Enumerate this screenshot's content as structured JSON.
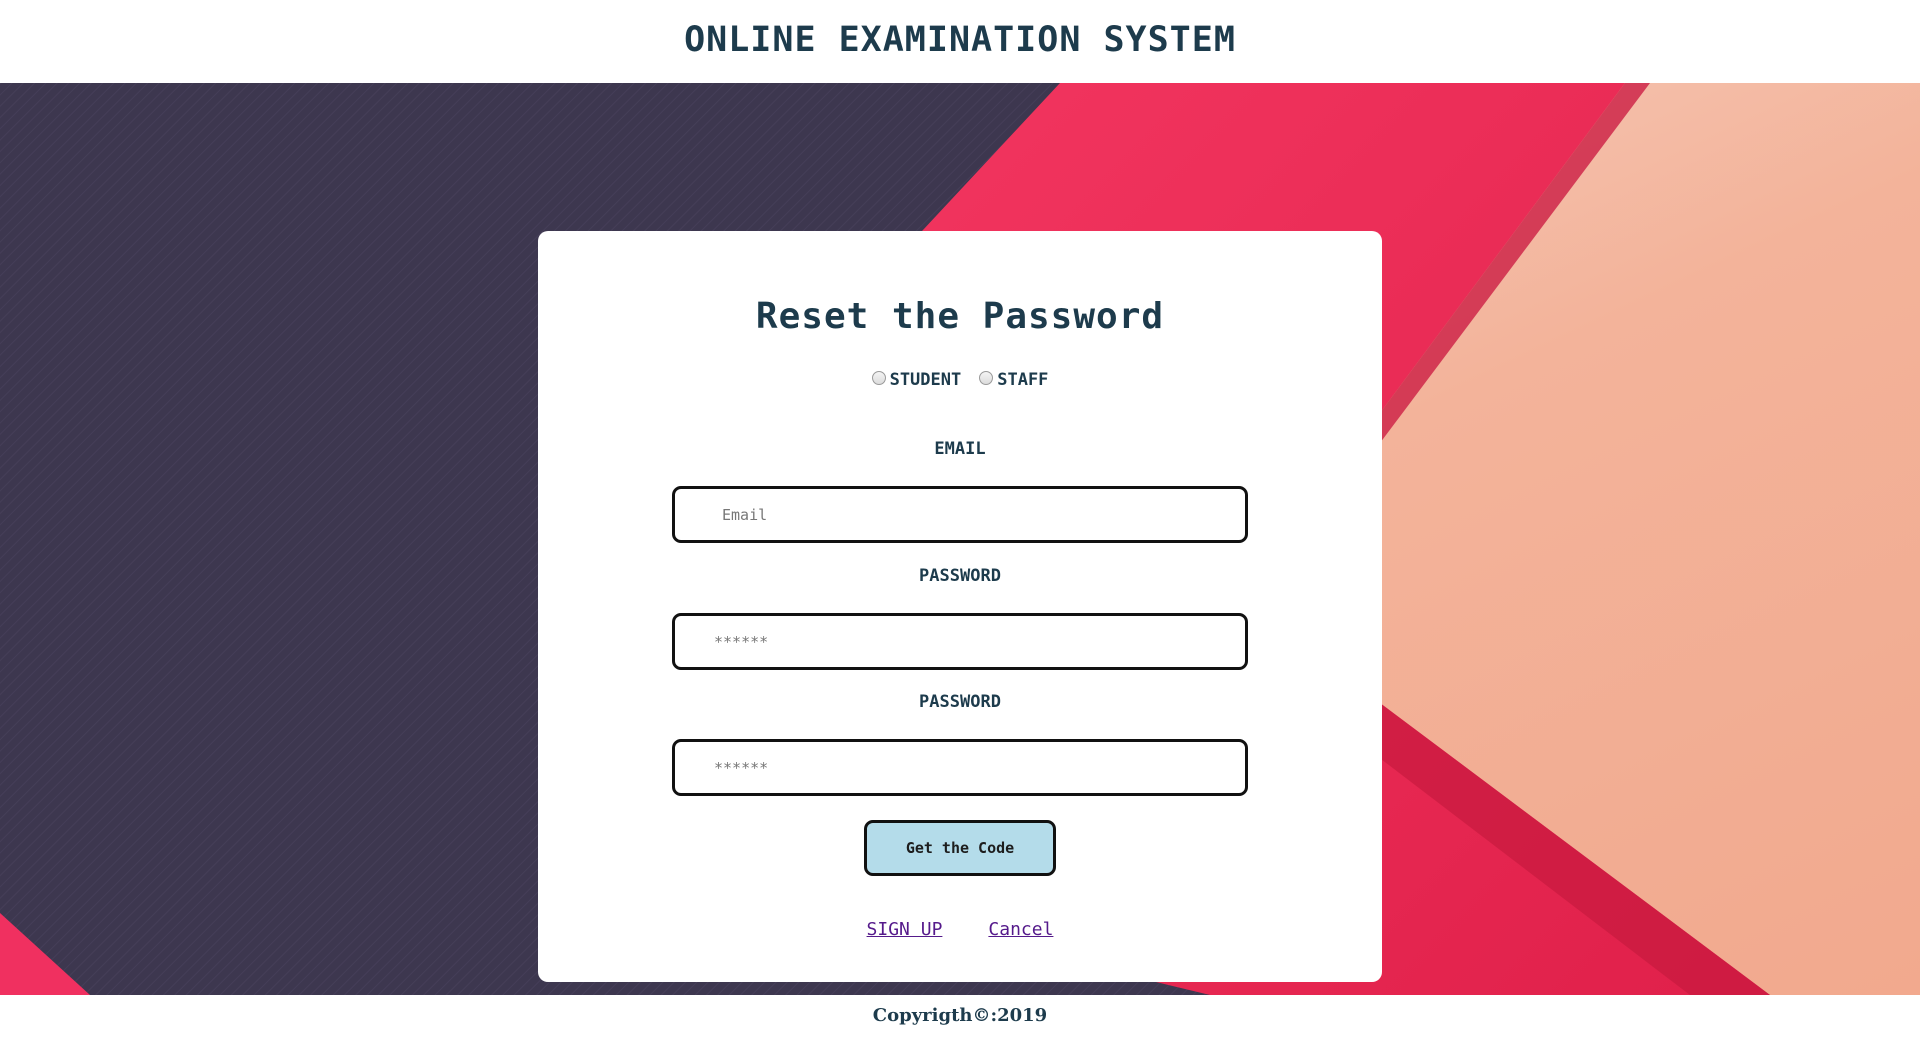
{
  "header": {
    "title": "ONLINE EXAMINATION SYSTEM"
  },
  "card": {
    "title": "Reset the Password",
    "roles": [
      {
        "label": "STUDENT",
        "checked": false
      },
      {
        "label": "STAFF",
        "checked": false
      }
    ],
    "email": {
      "label": "EMAIL",
      "placeholder": "Email"
    },
    "password": {
      "label": "PASSWORD",
      "placeholder": "******"
    },
    "confirm_password": {
      "label": "PASSWORD",
      "placeholder": "******"
    },
    "submit_label": "Get the Code",
    "links": {
      "signup": "SIGN UP",
      "cancel": "Cancel"
    }
  },
  "footer": {
    "copyright": "Copyrigth©:2019"
  },
  "colors": {
    "heading": "#1d3b4c",
    "bg_dark": "#3d374f",
    "bg_pink": "#f03060",
    "bg_peach": "#f4b39a",
    "button": "#b4dcea",
    "link": "#551a8b"
  }
}
